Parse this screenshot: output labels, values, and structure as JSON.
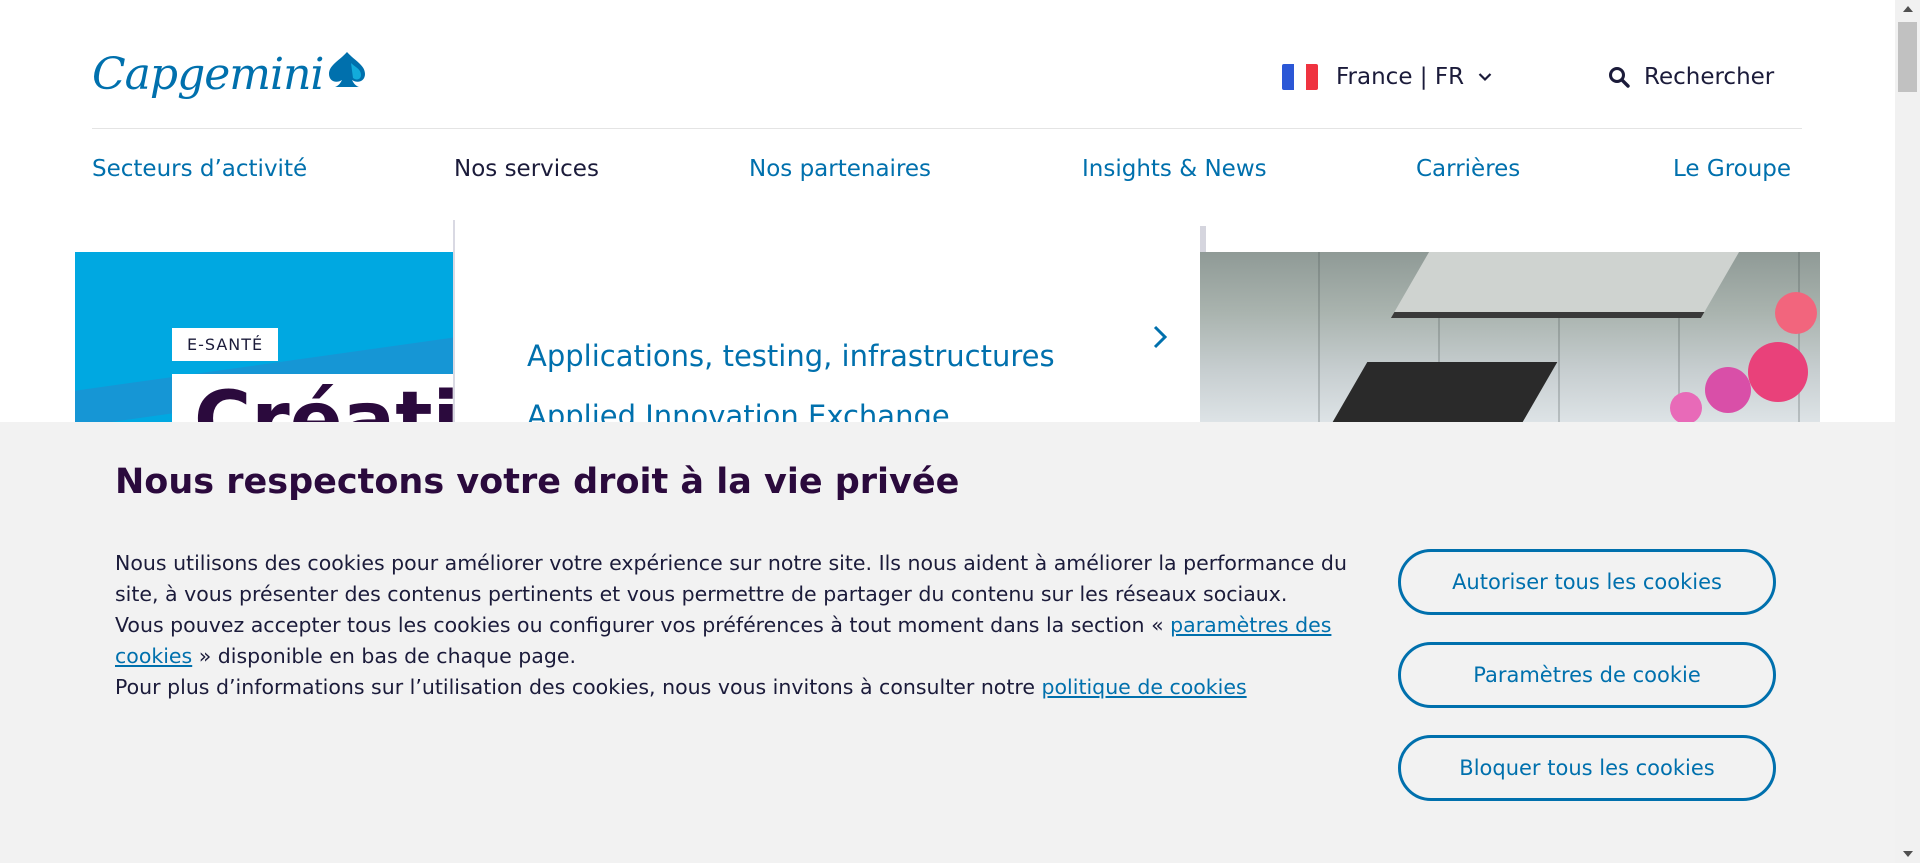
{
  "header": {
    "logo_text": "Capgemini",
    "language": {
      "label": "France | FR",
      "flag_colors": [
        "#2b57d6",
        "#ffffff",
        "#ef3340"
      ]
    },
    "search_label": "Rechercher"
  },
  "nav": {
    "items": [
      {
        "label": "Secteurs d’activité",
        "active": false
      },
      {
        "label": "Nos services",
        "active": true
      },
      {
        "label": "Nos partenaires",
        "active": false
      },
      {
        "label": "Insights & News",
        "active": false
      },
      {
        "label": "Carrières",
        "active": false
      },
      {
        "label": "Le Groupe",
        "active": false
      }
    ]
  },
  "mega_menu": {
    "promo_badge": "E-SANTÉ",
    "promo_title": "Créatio",
    "items": [
      {
        "label": "Applications, testing, infrastructures"
      },
      {
        "label": "Applied Innovation Exchange"
      }
    ]
  },
  "cookie_banner": {
    "title": "Nous respectons votre droit à la vie privée",
    "para1": "Nous utilisons des cookies pour améliorer votre expérience sur notre site. Ils nous aident à améliorer la performance du site, à vous présenter des contenus pertinents et vous permettre de partager du contenu sur les réseaux sociaux.",
    "para2_before": "Vous pouvez accepter tous les cookies ou configurer vos préférences à tout moment dans la section « ",
    "para2_link": "paramètres des cookies",
    "para2_after": " » disponible en bas de chaque page.",
    "para3_before": "Pour plus d’informations sur l’utilisation des cookies, nous vous invitons à consulter notre ",
    "para3_link": "politique de cookies",
    "buttons": {
      "allow_all": "Autoriser tous les cookies",
      "settings": "Paramètres de cookie",
      "block_all": "Bloquer tous les cookies"
    }
  },
  "colors": {
    "brand_blue": "#0070ad",
    "dark_purple": "#2b0a3d",
    "promo_blue": "#00a8e1",
    "banner_bg": "#f2f2f2"
  },
  "icons": {
    "logo": "spade-logo-icon",
    "dropdown": "chevron-down-icon",
    "search": "search-icon",
    "menu_arrow": "chevron-right-icon"
  }
}
